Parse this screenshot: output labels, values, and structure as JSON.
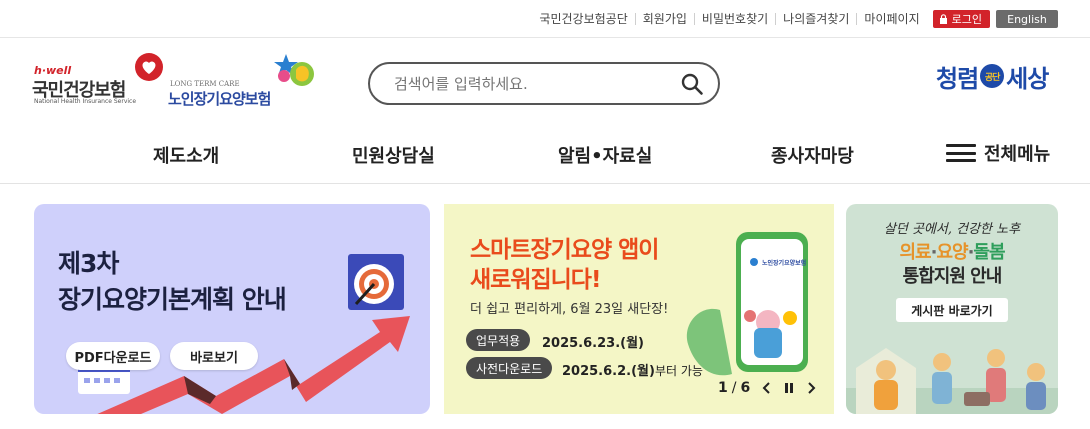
{
  "utility": {
    "links": [
      "국민건강보험공단",
      "회원가입",
      "비밀번호찾기",
      "나의즐겨찾기",
      "마이페이지"
    ],
    "login_label": "로그인",
    "english_label": "English",
    "colors": {
      "login": "#d2232a",
      "english": "#6b6b6b"
    }
  },
  "header": {
    "nhis_logo": {
      "brand": "h·well",
      "name": "국민건강보험",
      "english": "National Health Insurance Service"
    },
    "ltc_logo": {
      "english": "LONG TERM CARE",
      "name": "노인장기요양보험"
    },
    "search": {
      "placeholder": "검색어를 입력하세요."
    },
    "right_logo": {
      "left": "청렴",
      "center": "공단",
      "right": "세상"
    }
  },
  "nav": {
    "items": [
      "제도소개",
      "민원상담실",
      "알림•자료실",
      "종사자마당"
    ],
    "all_menu_label": "전체메뉴"
  },
  "banners": {
    "plan": {
      "title_line1": "제3차",
      "title_line2": "장기요양기본계획 안내",
      "pdf_button": "PDF다운로드",
      "view_button": "바로보기",
      "bg_color": "#cfd0fb"
    },
    "app": {
      "headline1": "스마트장기요양 앱이",
      "headline2": "새로워집니다!",
      "subtitle": "더 쉽고 편리하게, 6월 23일 새단장!",
      "tag1_label": "업무적용",
      "tag1_value": "2025.6.23.(월)",
      "tag2_label": "사전다운로드",
      "tag2_value": "2025.6.2.(월)",
      "tag2_suffix": "부터 가능",
      "phone_label": "노인장기요양보험",
      "pager_current": "1",
      "pager_sep": "/",
      "pager_total": "6",
      "bg_color": "#f4f6c6",
      "accent_color": "#e94b1c"
    },
    "integrated": {
      "slogan": "살던 곳에서, 건강한 노후",
      "title1_parts": [
        "의료",
        "·",
        "요양",
        "·",
        "돌봄"
      ],
      "title2": "통합지원 안내",
      "button": "게시판 바로가기",
      "bg_color": "#cfe2d3"
    }
  }
}
